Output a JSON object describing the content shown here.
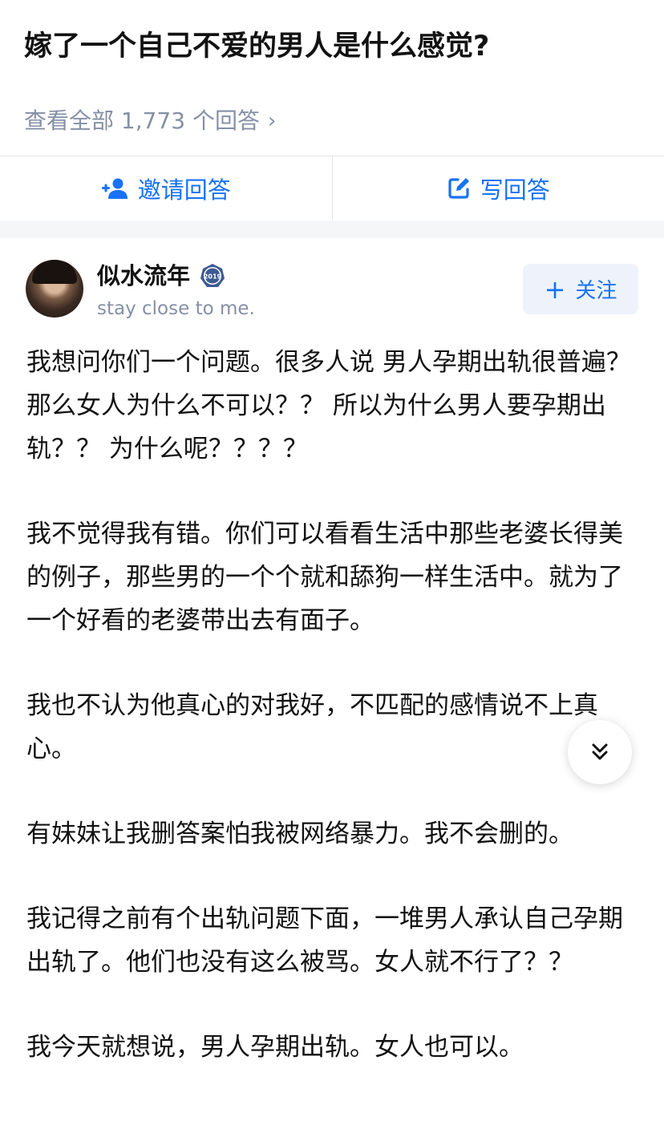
{
  "question": {
    "title": "嫁了一个自己不爱的男人是什么感觉?",
    "view_all_text": "查看全部 1,773 个回答"
  },
  "actions": {
    "invite_label": "邀请回答",
    "write_label": "写回答"
  },
  "author": {
    "name": "似水流年",
    "badge_text": "2019",
    "bio": "stay close to me.",
    "follow_label": "关注"
  },
  "answer": {
    "paragraphs": [
      "我想问你们一个问题。很多人说 男人孕期出轨很普遍？那么女人为什么不可以？？ 所以为什么男人要孕期出轨？？ 为什么呢？？？？",
      "我不觉得我有错。你们可以看看生活中那些老婆长得美的例子，那些男的一个个就和舔狗一样生活中。就为了一个好看的老婆带出去有面子。",
      "我也不认为他真心的对我好，不匹配的感情说不上真心。",
      "有妹妹让我删答案怕我被网络暴力。我不会删的。",
      "我记得之前有个出轨问题下面，一堆男人承认自己孕期出轨了。他们也没有这么被骂。女人就不行了？？",
      "我今天就想说，男人孕期出轨。女人也可以。"
    ]
  },
  "icons": {
    "invite": "add-user-icon",
    "write": "edit-icon",
    "badge": "medal-badge-icon",
    "scroll": "double-chevron-down-icon",
    "view_all_chevron": "chevron-right-icon"
  },
  "colors": {
    "accent": "#1772f6",
    "muted": "#8590a6",
    "text": "#121212",
    "follow_bg": "#eef3fb",
    "band": "#f5f6f7"
  }
}
